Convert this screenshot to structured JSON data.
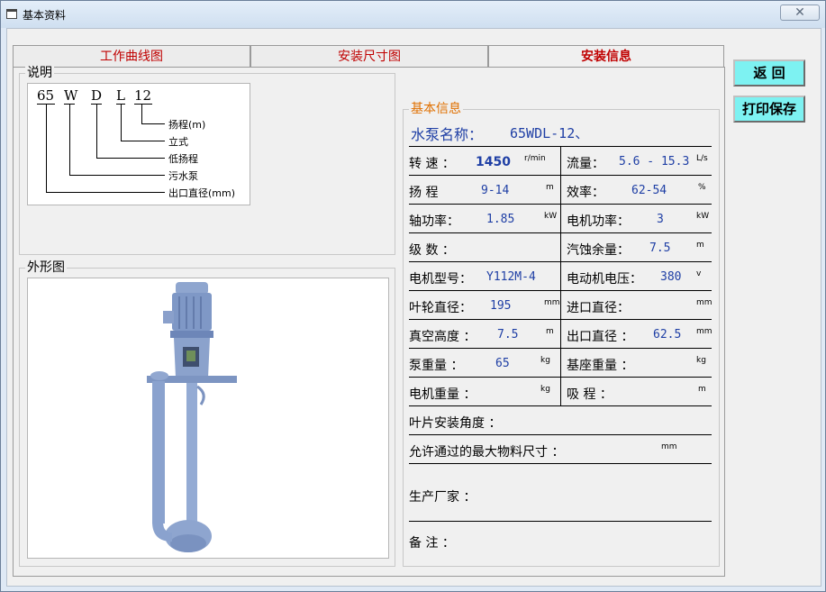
{
  "window": {
    "title": "基本资料",
    "close_glyph": "✕"
  },
  "tabs": [
    {
      "label": "工作曲线图"
    },
    {
      "label": "安装尺寸图"
    },
    {
      "label": "安装信息"
    }
  ],
  "buttons": {
    "back_label": "返  回",
    "print_save_label": "打印保存"
  },
  "description": {
    "group_label": "说明",
    "code_parts": [
      "65",
      "W",
      "D",
      "L",
      "12"
    ],
    "meanings": [
      "扬程(m)",
      "立式",
      "低扬程",
      "污水泵",
      "出口直径(mm)"
    ]
  },
  "outline": {
    "group_label": "外形图"
  },
  "basic_info": {
    "group_label": "基本信息",
    "pump_name_label": "水泵名称：",
    "pump_name_value": "65WDL-12、",
    "speed": {
      "label": "转 速 ：",
      "value": "1450",
      "unit": "r/min"
    },
    "flow": {
      "label": "流量：",
      "value": "5.6 - 15.3",
      "unit": "L/s"
    },
    "head": {
      "label": "扬 程",
      "value": "9-14",
      "unit": "m"
    },
    "efficiency": {
      "label": "效率：",
      "value": "62-54",
      "unit": "%"
    },
    "shaft_power": {
      "label": "轴功率：",
      "value": "1.85",
      "unit": "kW"
    },
    "motor_power": {
      "label": "电机功率：",
      "value": "3",
      "unit": "kW"
    },
    "stages": {
      "label": "级 数 ："
    },
    "npsh": {
      "label": "汽蚀余量：",
      "value": "7.5",
      "unit": "m"
    },
    "motor_model": {
      "label": "电机型号：",
      "value": "Y112M-4"
    },
    "motor_voltage": {
      "label": "电动机电压：",
      "value": "380",
      "unit": "v"
    },
    "impeller_dia": {
      "label": "叶轮直径：",
      "value": "195",
      "unit": "mm"
    },
    "inlet_dia": {
      "label": "进口直径：",
      "unit": "mm"
    },
    "vacuum_height": {
      "label": "真空高度 ：",
      "value": "7.5",
      "unit": "m"
    },
    "outlet_dia": {
      "label": "出口直径 ：",
      "value": "62.5",
      "unit": "mm"
    },
    "pump_weight": {
      "label": "泵重量 ：",
      "value": "65",
      "unit": "kg"
    },
    "base_weight": {
      "label": "基座重量 ：",
      "unit": "kg"
    },
    "motor_weight": {
      "label": "电机重量 ：",
      "unit": "kg"
    },
    "suction_lift": {
      "label": "吸 程 ：",
      "unit": "m"
    },
    "blade_angle": {
      "label": "叶片安装角度 ："
    },
    "max_particle": {
      "label": "允许通过的最大物料尺寸 ：",
      "unit": "mm"
    },
    "manufacturer": {
      "label": "生产厂家 ："
    },
    "remarks": {
      "label": "备  注 ："
    }
  }
}
